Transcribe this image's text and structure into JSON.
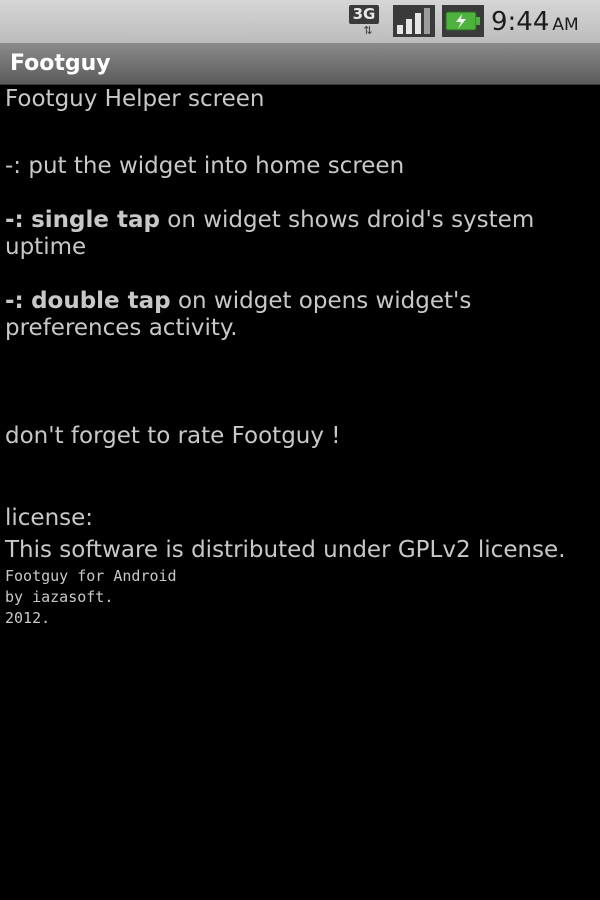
{
  "status_bar": {
    "network_label": "3G",
    "time": "9:44",
    "ampm": "AM",
    "icons": [
      "3g-icon",
      "signal-icon",
      "battery-charging-icon"
    ]
  },
  "title_bar": {
    "title": "Footguy"
  },
  "content": {
    "heading": "Footguy Helper screen",
    "item1_prefix": "-:",
    "item1_text": "put the widget into home screen",
    "item2_prefix": "-:",
    "item2_bold": "single tap",
    "item2_text": "on widget shows droid's system uptime",
    "item3_prefix": "-:",
    "item3_bold": "double tap",
    "item3_text": "on widget opens widget's preferences activity.",
    "rate_text": "don't forget to rate Footguy !",
    "license_label": "license:",
    "license_text": "This software is distributed under GPLv2 license.",
    "credits_line1": "Footguy for Android",
    "credits_line2": "by iazasoft.",
    "credits_line3": "2012."
  }
}
